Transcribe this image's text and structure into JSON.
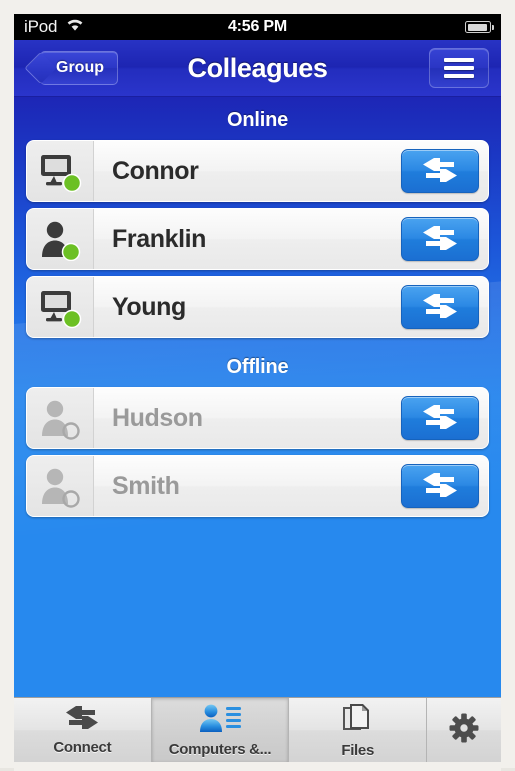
{
  "status_bar": {
    "carrier": "iPod",
    "wifi_icon": "wifi-icon",
    "time": "4:56 PM",
    "battery_icon": "battery-icon"
  },
  "nav_bar": {
    "back_label": "Group",
    "title": "Colleagues",
    "menu_icon": "hamburger-menu-icon"
  },
  "sections": [
    {
      "header": "Online",
      "contacts": [
        {
          "name": "Connor",
          "avatar_icon": "monitor-icon",
          "status": "online",
          "status_icon": "green-dot-icon",
          "action_icon": "connect-arrows-icon"
        },
        {
          "name": "Franklin",
          "avatar_icon": "person-icon",
          "status": "online",
          "status_icon": "green-dot-icon",
          "action_icon": "connect-arrows-icon"
        },
        {
          "name": "Young",
          "avatar_icon": "monitor-icon",
          "status": "online",
          "status_icon": "green-dot-icon",
          "action_icon": "connect-arrows-icon"
        }
      ]
    },
    {
      "header": "Offline",
      "contacts": [
        {
          "name": "Hudson",
          "avatar_icon": "person-icon",
          "status": "offline",
          "status_icon": "hollow-circle-icon",
          "action_icon": "connect-arrows-icon"
        },
        {
          "name": "Smith",
          "avatar_icon": "person-icon",
          "status": "offline",
          "status_icon": "hollow-circle-icon",
          "action_icon": "connect-arrows-icon"
        }
      ]
    }
  ],
  "tab_bar": {
    "tabs": [
      {
        "label": "Connect",
        "icon": "connect-arrows-icon",
        "active": false
      },
      {
        "label": "Computers &...",
        "icon": "computers-people-icon",
        "active": true
      },
      {
        "label": "Files",
        "icon": "files-icon",
        "active": false
      },
      {
        "label": "",
        "icon": "gear-icon",
        "active": false
      }
    ]
  },
  "colors": {
    "accent_blue": "#2789ee",
    "nav_blue": "#232dbe",
    "online_green": "#6cc024",
    "offline_gray": "#9a9a9a",
    "button_blue": "#2b88e4"
  }
}
